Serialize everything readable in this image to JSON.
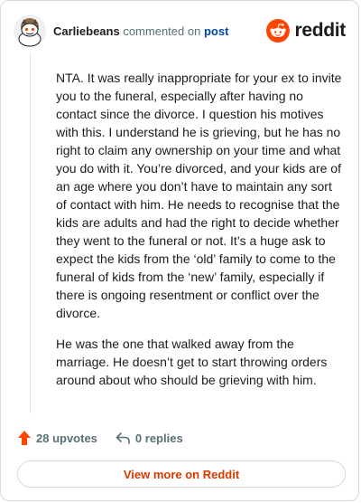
{
  "header": {
    "username": "Carliebeans",
    "action_text": "commented on",
    "post_link": "post",
    "brand": "reddit"
  },
  "comment": {
    "paragraphs": [
      "NTA. It was really inappropriate for your ex to invite you to the funeral, especially after having no contact since the divorce. I question his motives with this. I understand he is grieving, but he has no right to claim any ownership on your time and what you do with it. You’re divorced, and your kids are of an age where you don’t have to maintain any sort of contact with him. He needs to recognise that the kids are adults and had the right to decide whether they went to the funeral or not. It’s a huge ask to expect the kids from the ‘old’ family to come to the funeral of kids from the ‘new’ family, especially if there is ongoing resentment or conflict over the divorce.",
      "He was the one that walked away from the marriage. He doesn’t get to start throwing orders around about who should be grieving with him."
    ]
  },
  "actions": {
    "upvotes": "28 upvotes",
    "replies": "0 replies"
  },
  "footer": {
    "view_more": "View more on Reddit"
  },
  "colors": {
    "reddit_orange": "#ff4500",
    "link_blue": "#0045ac",
    "view_more_text": "#d93900"
  },
  "icons": {
    "avatar": "snoo-avatar-icon",
    "brand": "reddit-logo-icon",
    "upvote": "upvote-arrow-icon",
    "reply": "reply-arrow-icon"
  }
}
